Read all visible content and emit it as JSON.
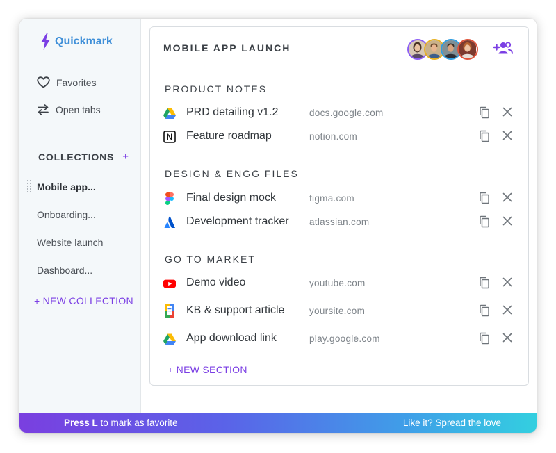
{
  "brand": {
    "name": "Quickmark",
    "icon": "lightning-bolt-icon",
    "color": "#3f8fd8"
  },
  "sidebar": {
    "nav": [
      {
        "label": "Favorites",
        "icon": "heart-icon"
      },
      {
        "label": "Open tabs",
        "icon": "swap-arrows-icon"
      }
    ],
    "collections_label": "COLLECTIONS",
    "collections_add": "+",
    "collections": [
      {
        "label": "Mobile app...",
        "active": true
      },
      {
        "label": "Onboarding...",
        "active": false
      },
      {
        "label": "Website launch",
        "active": false
      },
      {
        "label": "Dashboard...",
        "active": false
      }
    ],
    "new_collection": "+ NEW COLLECTION"
  },
  "collection": {
    "title": "MOBILE APP LAUNCH",
    "add_people_icon": "add-people-icon",
    "sections": [
      {
        "title": "PRODUCT NOTES",
        "links": [
          {
            "name": "PRD detailing v1.2",
            "domain": "docs.google.com",
            "icon": "google-drive-icon"
          },
          {
            "name": "Feature roadmap",
            "domain": "notion.com",
            "icon": "notion-icon"
          }
        ]
      },
      {
        "title": "DESIGN & ENGG FILES",
        "links": [
          {
            "name": "Final design mock",
            "domain": "figma.com",
            "icon": "figma-icon"
          },
          {
            "name": "Development tracker",
            "domain": "atlassian.com",
            "icon": "atlassian-icon"
          }
        ]
      },
      {
        "title": "GO TO MARKET",
        "links": [
          {
            "name": "Demo video",
            "domain": "youtube.com",
            "icon": "youtube-icon"
          },
          {
            "name": "KB & support article",
            "domain": "yoursite.com",
            "icon": "google-docs-icon"
          },
          {
            "name": "App download link",
            "domain": "play.google.com",
            "icon": "google-drive-icon"
          }
        ]
      }
    ],
    "new_section": "+ NEW SECTION"
  },
  "footer": {
    "hint_key": "Press L",
    "hint_rest": " to mark as favorite",
    "love_link": "Like it? Spread the love"
  },
  "colors": {
    "accent": "#7b3fe4",
    "footer_start": "#7a3fe0",
    "footer_end": "#33cfe0"
  }
}
